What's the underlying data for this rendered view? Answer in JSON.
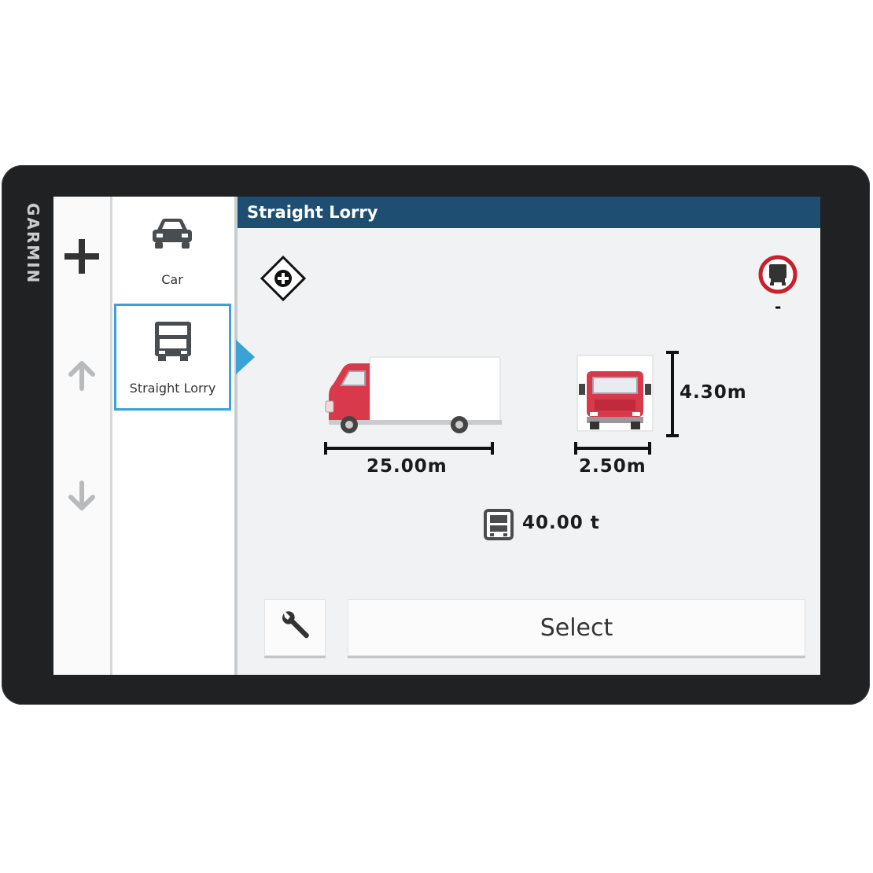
{
  "device": {
    "brand": "GARMIN"
  },
  "header": {
    "title": "Straight Lorry"
  },
  "side_controls": {
    "add_icon": "plus-icon",
    "up_icon": "arrow-up-icon",
    "down_icon": "arrow-down-icon"
  },
  "profiles": [
    {
      "label": "Car",
      "icon": "car-icon",
      "selected": false
    },
    {
      "label": "Straight Lorry",
      "icon": "lorry-icon",
      "selected": true
    }
  ],
  "vehicle": {
    "length": "25.00m",
    "width": "2.50m",
    "height": "4.30m",
    "weight": "40.00 t",
    "restriction_value": "-"
  },
  "actions": {
    "select_label": "Select",
    "settings_icon": "wrench-icon"
  },
  "colors": {
    "header_bg": "#1e4f73",
    "selection_accent": "#3aa3d4",
    "truck_red": "#d8394b",
    "restriction_ring": "#c8202c"
  }
}
